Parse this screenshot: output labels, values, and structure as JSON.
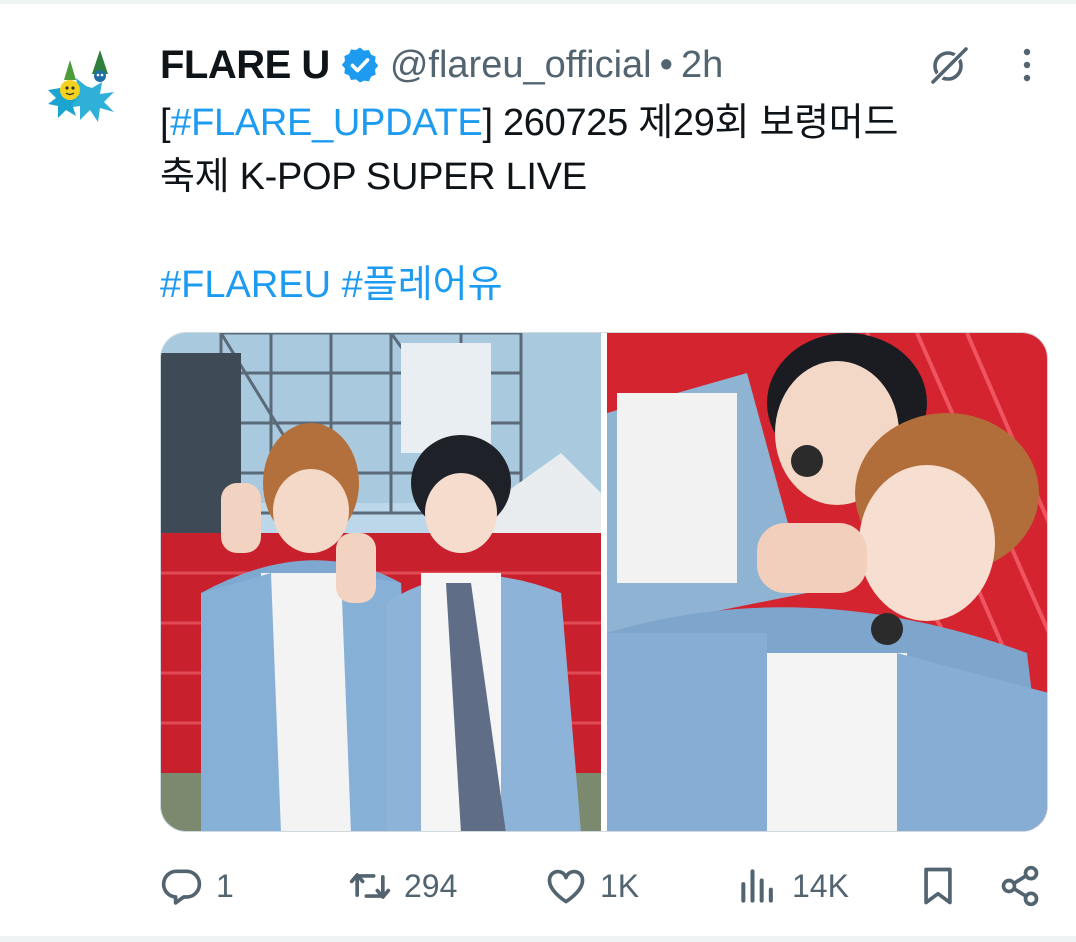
{
  "tweet": {
    "author": {
      "name": "FLARE U",
      "handle": "@flareu_official",
      "separator": "•",
      "time": "2h",
      "verified": true
    },
    "text": {
      "open_bracket": "[",
      "hashtag_update": "#FLARE_UPDATE",
      "line1_rest": "] 260725 제29회 보령머드",
      "line2": "축제 K-POP SUPER LIVE",
      "hashtag1": "#FLAREU",
      "hashtag2": "#플레어유"
    },
    "media": {
      "count": 2,
      "items": [
        "photo-1",
        "photo-2"
      ]
    },
    "actions": {
      "replies": "1",
      "reposts": "294",
      "likes": "1K",
      "views": "14K"
    }
  },
  "icons": [
    "verified-badge-icon",
    "grok-icon",
    "more-icon",
    "reply-icon",
    "repost-icon",
    "like-icon",
    "views-icon",
    "bookmark-icon",
    "share-icon"
  ],
  "colors": {
    "accent": "#1d9bf0",
    "secondary_text": "#536471",
    "primary_text": "#0f1419",
    "border": "#cfd9de"
  }
}
